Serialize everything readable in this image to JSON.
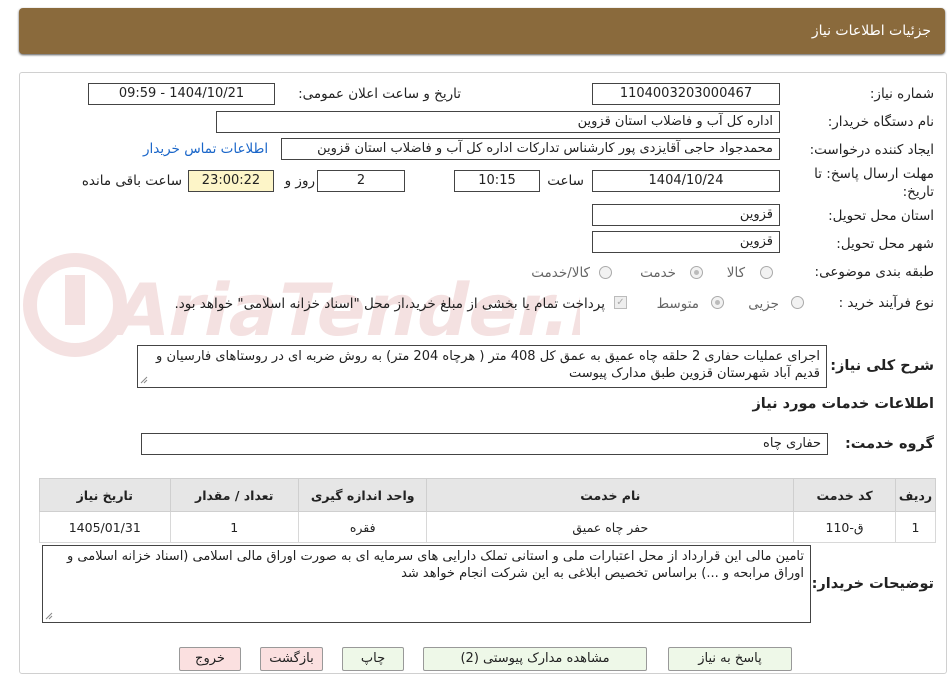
{
  "header": {
    "title": "جزئیات اطلاعات نیاز"
  },
  "watermark": {
    "text": "AriaTender.neT"
  },
  "need_number": {
    "label": "شماره نیاز:",
    "value": "1104003203000467"
  },
  "announce": {
    "label": "تاریخ و ساعت اعلان عمومی:",
    "value": "1404/10/21 - 09:59"
  },
  "buyer_org": {
    "label": "نام دستگاه خریدار:",
    "value": "اداره کل آب و فاضلاب استان قزوین"
  },
  "requester": {
    "label": "ایجاد کننده درخواست:",
    "value": "محمدجواد حاجی آقایزدی پور کارشناس تدارکات اداره کل آب و فاضلاب استان قزوین",
    "contact_link": "اطلاعات تماس خریدار"
  },
  "deadline": {
    "label_line1": "مهلت ارسال پاسخ: تا",
    "label_line2": "تاریخ:",
    "date": "1404/10/24",
    "time_label": "ساعت",
    "time": "10:15",
    "days": "2",
    "days_label": "روز و",
    "remaining": "23:00:22",
    "remaining_label": "ساعت باقی مانده"
  },
  "province": {
    "label": "استان محل تحویل:",
    "value": "قزوین"
  },
  "city": {
    "label": "شهر محل تحویل:",
    "value": "قزوین"
  },
  "category": {
    "label": "طبقه بندی موضوعی:",
    "options": [
      "کالا",
      "خدمت",
      "کالا/خدمت"
    ],
    "selected": "خدمت"
  },
  "process": {
    "label": "نوع فرآیند خرید :",
    "options": [
      "جزیی",
      "متوسط"
    ],
    "selected": "متوسط",
    "payment_note": "پرداخت تمام یا بخشی از مبلغ خرید،از محل \"اسناد خزانه اسلامی\" خواهد بود."
  },
  "description": {
    "label": "شرح کلی نیاز:",
    "value": "اجرای عملیات حفاری 2 حلقه چاه عمیق به عمق کل 408 متر ( هرچاه 204 متر) به روش ضربه ای در روستاهای فارسیان و قدیم آباد شهرستان قزوین طبق مدارک پیوست"
  },
  "services_title": "اطلاعات خدمات مورد نیاز",
  "service_group": {
    "label": "گروه خدمت:",
    "value": "حفاری چاه"
  },
  "table": {
    "headers": [
      "ردیف",
      "کد خدمت",
      "نام خدمت",
      "واحد اندازه گیری",
      "تعداد / مقدار",
      "تاریخ نیاز"
    ],
    "rows": [
      [
        "1",
        "ق-110",
        "حفر چاه عمیق",
        "فقره",
        "1",
        "1405/01/31"
      ]
    ]
  },
  "buyer_notes": {
    "label": "توضیحات خریدار:",
    "value": "تامین مالی این قرارداد از محل اعتبارات ملی و استانی تملک دارایی های سرمایه ای به صورت اوراق مالی اسلامی (اسناد خزانه اسلامی و اوراق مرابحه و ...) براساس تخصیص ابلاغی به این شرکت انجام خواهد شد"
  },
  "buttons": {
    "respond": "پاسخ به نیاز",
    "attachments": "مشاهده مدارک پیوستی (2)",
    "print": "چاپ",
    "back": "بازگشت",
    "exit": "خروج"
  }
}
